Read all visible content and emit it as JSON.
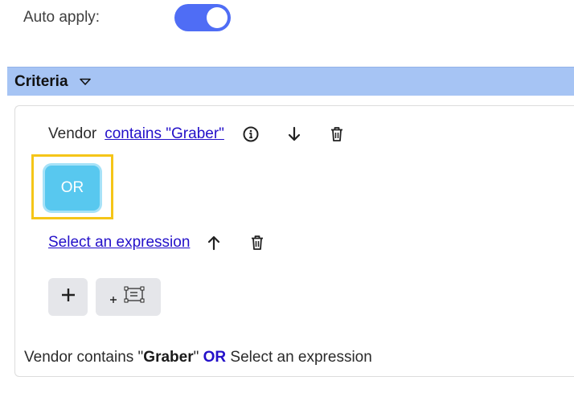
{
  "auto_apply": {
    "label": "Auto apply:",
    "enabled": true
  },
  "criteria": {
    "title": "Criteria",
    "rows": [
      {
        "field": "Vendor",
        "expression": "contains \"Graber\""
      },
      {
        "field": "",
        "expression": "Select an expression"
      }
    ],
    "operator": "OR",
    "summary": {
      "part1": "Vendor contains \"",
      "value": "Graber",
      "part2": "\" ",
      "operator": "OR",
      "part3": " Select an expression"
    }
  },
  "icons": {
    "collapse": "chevron-down-icon",
    "info": "info-icon",
    "move_down": "arrow-down-icon",
    "move_up": "arrow-up-icon",
    "delete": "trash-icon",
    "add": "plus-icon",
    "add_group": "add-group-icon"
  },
  "colors": {
    "toggle_on": "#4f6df5",
    "header_bg": "#a6c4f4",
    "or_button": "#58c8ef",
    "highlight": "#f5c518",
    "link": "#2310c9"
  }
}
